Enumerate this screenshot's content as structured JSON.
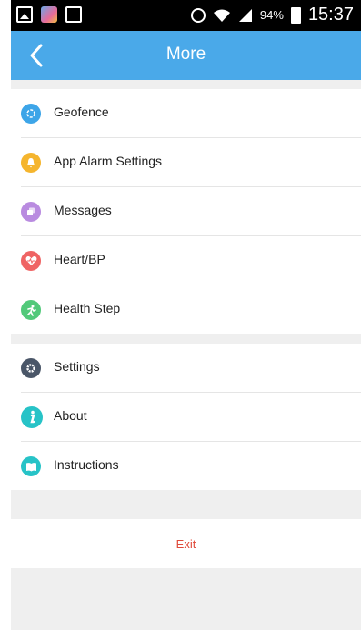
{
  "status_bar": {
    "battery": "94%",
    "time": "15:37"
  },
  "header": {
    "title": "More"
  },
  "menu_group_1": [
    {
      "label": "Geofence",
      "icon": "geofence-icon",
      "color": "#3da5e8"
    },
    {
      "label": "App Alarm Settings",
      "icon": "bell-icon",
      "color": "#f5b52e"
    },
    {
      "label": "Messages",
      "icon": "messages-icon",
      "color": "#b98be0"
    },
    {
      "label": "Heart/BP",
      "icon": "heart-icon",
      "color": "#ef6464"
    },
    {
      "label": "Health Step",
      "icon": "runner-icon",
      "color": "#52c97a"
    }
  ],
  "menu_group_2": [
    {
      "label": "Settings",
      "icon": "gear-icon",
      "color": "#4a5668"
    },
    {
      "label": "About",
      "icon": "info-icon",
      "color": "#27c3c7"
    },
    {
      "label": "Instructions",
      "icon": "book-icon",
      "color": "#27c3c7"
    }
  ],
  "exit_label": "Exit",
  "colors": {
    "header": "#4aa9e9",
    "exit": "#e04a3a",
    "separator": "#efefef"
  }
}
